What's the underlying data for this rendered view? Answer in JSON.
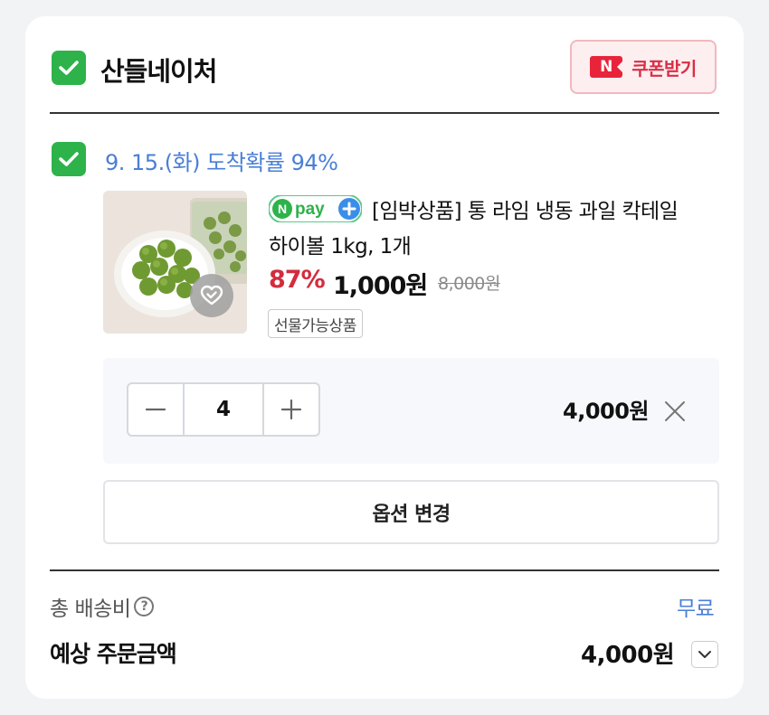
{
  "store": {
    "name": "산들네이처",
    "checked": true,
    "coupon_badge": "N",
    "coupon_label": "쿠폰받기"
  },
  "delivery": {
    "checked": true,
    "text": "9. 15.(화) 도착확률 94%"
  },
  "product": {
    "npay_text": "pay",
    "title_line1": "[임박상품] 통 라임 냉동 과일 칵테일",
    "title_line2": "하이볼 1kg, 1개",
    "discount": "87%",
    "price": "1,000원",
    "original_price": "8,000원",
    "tag": "선물가능상품",
    "quantity": "4",
    "line_total": "4,000원",
    "option_change_label": "옵션 변경"
  },
  "summary": {
    "shipping_label": "총 배송비",
    "shipping_value": "무료",
    "estimated_label": "예상 주문금액",
    "estimated_value": "4,000원"
  },
  "colors": {
    "check_green": "#2db34a",
    "accent_blue": "#4a7fd6",
    "discount_red": "#d42b3e",
    "coupon_red": "#e8243a"
  },
  "icons": [
    "checkmark-icon",
    "naver-n-icon",
    "heart-check-icon",
    "npay-plus-icon",
    "minus-icon",
    "plus-icon",
    "close-icon",
    "question-icon",
    "chevron-down-icon"
  ]
}
